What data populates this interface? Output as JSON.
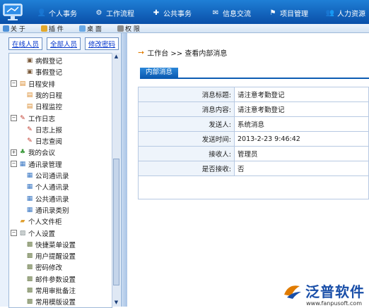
{
  "topnav": {
    "items": [
      {
        "label": "个人事务",
        "icon": "person-icon",
        "color": "#f5c542"
      },
      {
        "label": "工作流程",
        "icon": "workflow-icon",
        "color": "#f0a030"
      },
      {
        "label": "公共事务",
        "icon": "public-icon",
        "color": "#6ad06a"
      },
      {
        "label": "信息交流",
        "icon": "message-icon",
        "color": "#f8f8f8"
      },
      {
        "label": "项目管理",
        "icon": "project-icon",
        "color": "#f5c542"
      },
      {
        "label": "人力资源",
        "icon": "hr-icon",
        "color": "#f5c542"
      }
    ]
  },
  "toolbar": {
    "items": [
      {
        "label": "关 于",
        "icon": "info-icon"
      },
      {
        "label": "插 件",
        "icon": "plugin-icon"
      },
      {
        "label": "桌 面",
        "icon": "desktop-icon"
      },
      {
        "label": "权 限",
        "icon": "permission-icon"
      }
    ]
  },
  "sidebar": {
    "tabs": [
      "在线人员",
      "全部人员",
      "修改密码"
    ],
    "tree": [
      {
        "label": "病假登记",
        "level": 1,
        "icon": "leave-icon",
        "toggle": ""
      },
      {
        "label": "事假登记",
        "level": 1,
        "icon": "leave-icon",
        "toggle": ""
      },
      {
        "label": "日程安排",
        "level": 0,
        "icon": "schedule-icon",
        "toggle": "−"
      },
      {
        "label": "我的日程",
        "level": 1,
        "icon": "schedule-icon",
        "toggle": ""
      },
      {
        "label": "日程监控",
        "level": 1,
        "icon": "schedule-icon",
        "toggle": ""
      },
      {
        "label": "工作日志",
        "level": 0,
        "icon": "pencil-icon",
        "toggle": "−"
      },
      {
        "label": "日志上报",
        "level": 1,
        "icon": "pencil-icon",
        "toggle": ""
      },
      {
        "label": "日志查阅",
        "level": 1,
        "icon": "pencil-icon",
        "toggle": ""
      },
      {
        "label": "我的会议",
        "level": 0,
        "icon": "meeting-icon",
        "toggle": "+"
      },
      {
        "label": "通讯录管理",
        "level": 0,
        "icon": "addressbook-icon",
        "toggle": "−"
      },
      {
        "label": "公司通讯录",
        "level": 1,
        "icon": "addressbook-icon",
        "toggle": ""
      },
      {
        "label": "个人通讯录",
        "level": 1,
        "icon": "addressbook-icon",
        "toggle": ""
      },
      {
        "label": "公共通讯录",
        "level": 1,
        "icon": "addressbook-icon",
        "toggle": ""
      },
      {
        "label": "通讯录类别",
        "level": 1,
        "icon": "addressbook-icon",
        "toggle": ""
      },
      {
        "label": "个人文件柜",
        "level": 0,
        "icon": "folder-icon",
        "toggle": ""
      },
      {
        "label": "个人设置",
        "level": 0,
        "icon": "settings-icon",
        "toggle": "−"
      },
      {
        "label": "快捷菜单设置",
        "level": 1,
        "icon": "settings-item-icon",
        "toggle": ""
      },
      {
        "label": "用户提醒设置",
        "level": 1,
        "icon": "settings-item-icon",
        "toggle": ""
      },
      {
        "label": "密码修改",
        "level": 1,
        "icon": "settings-item-icon",
        "toggle": ""
      },
      {
        "label": "邮件参数设置",
        "level": 1,
        "icon": "settings-item-icon",
        "toggle": ""
      },
      {
        "label": "常用审批备注",
        "level": 1,
        "icon": "settings-item-icon",
        "toggle": ""
      },
      {
        "label": "常用模版设置",
        "level": 1,
        "icon": "settings-item-icon",
        "toggle": ""
      }
    ]
  },
  "main": {
    "breadcrumb": "工作台 >> 查看内部消息",
    "tab_label": "内部消息",
    "fields": [
      {
        "label": "消息标题:",
        "value": "请注意考勤登记"
      },
      {
        "label": "消息内容:",
        "value": "请注意考勤登记"
      },
      {
        "label": "发送人:",
        "value": "系统消息"
      },
      {
        "label": "发送时间:",
        "value": "2013-2-23 9:46:42"
      },
      {
        "label": "接收人:",
        "value": "管理员"
      },
      {
        "label": "是否接收:",
        "value": "否"
      }
    ]
  },
  "brand": {
    "name": "泛普软件",
    "url": "www.fanpusoft.com",
    "colors": {
      "primary": "#1a4fa8",
      "accent": "#e07b00"
    }
  }
}
